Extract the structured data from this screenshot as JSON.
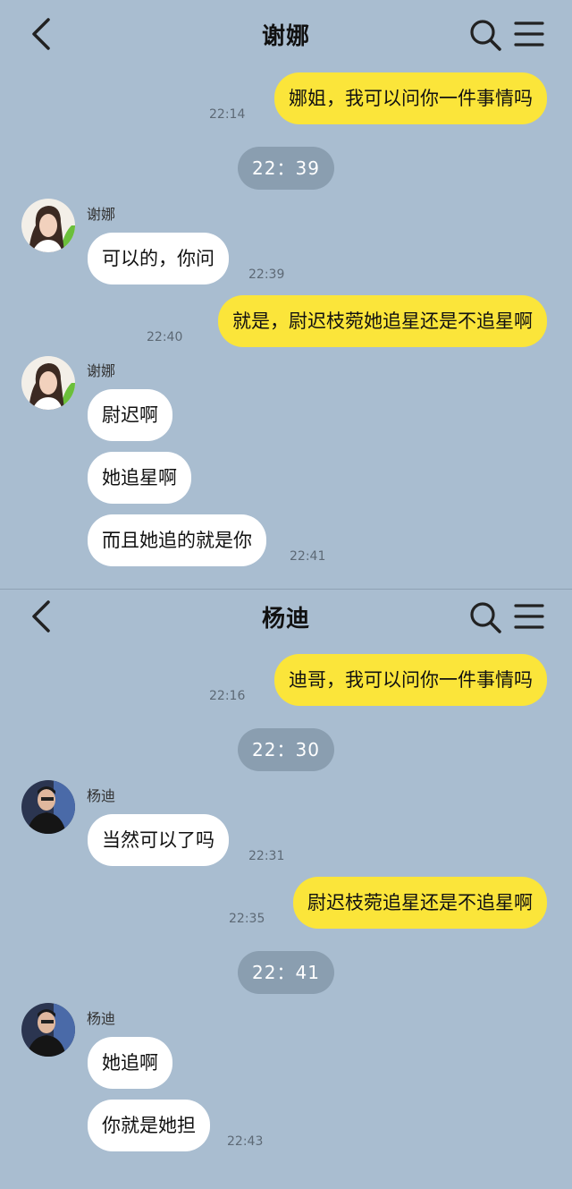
{
  "chat1": {
    "title": "谢娜",
    "sender_name": "谢娜",
    "m1_text": "娜姐，我可以问你一件事情吗",
    "m1_time": "22:14",
    "stamp1": "22：39",
    "m2_text": "可以的，你问",
    "m2_time": "22:39",
    "m3_text": "就是，尉迟枝菀她追星还是不追星啊",
    "m3_time": "22:40",
    "m4_text": "尉迟啊",
    "m5_text": "她追星啊",
    "m6_text": "而且她追的就是你",
    "m6_time": "22:41"
  },
  "chat2": {
    "title": "杨迪",
    "sender_name": "杨迪",
    "m1_text": "迪哥，我可以问你一件事情吗",
    "m1_time": "22:16",
    "stamp1": "22：30",
    "m2_text": "当然可以了吗",
    "m2_time": "22:31",
    "m3_text": "尉迟枝菀追星还是不追星啊",
    "m3_time": "22:35",
    "stamp2": "22：41",
    "m4_text": "她追啊",
    "m5_text": "你就是她担",
    "m5_time": "22:43"
  },
  "colors": {
    "background": "#a9bdd0",
    "my_bubble": "#fbe53a",
    "their_bubble": "#ffffff",
    "stamp": "#8a9eb0"
  },
  "icons": [
    "back-arrow-icon",
    "search-icon",
    "menu-icon"
  ]
}
